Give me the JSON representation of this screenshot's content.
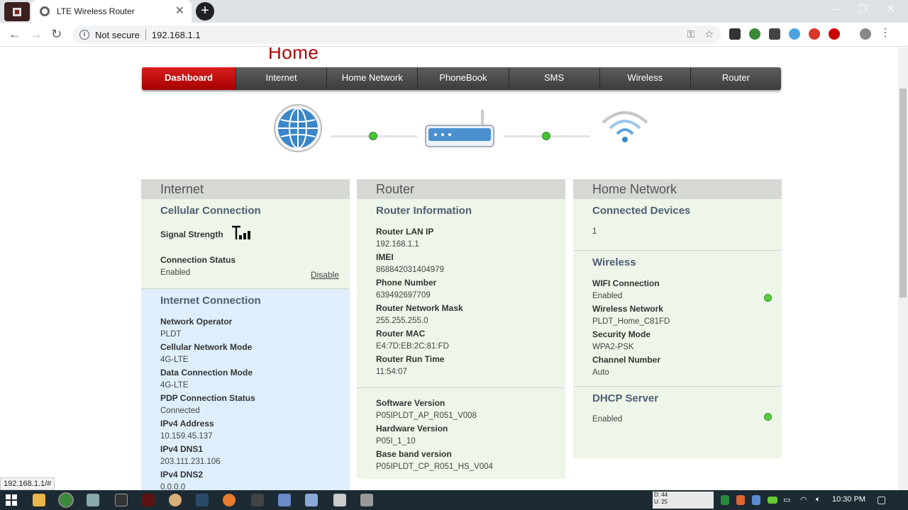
{
  "browser": {
    "tab_title": "LTE Wireless Router",
    "tab_close": "✕",
    "new_tab": "+",
    "not_secure": "Not secure",
    "url": "192.168.1.1",
    "hover_url": "192.168.1.1/#"
  },
  "page": {
    "title": "Home",
    "nav": [
      "Dashboard",
      "Internet",
      "Home Network",
      "PhoneBook",
      "SMS",
      "Wireless",
      "Router"
    ],
    "active_nav": "Dashboard"
  },
  "internet_panel": {
    "heading": "Internet",
    "cellular": {
      "title": "Cellular Connection",
      "signal_label": "Signal Strength",
      "status_label": "Connection Status",
      "status_value": "Enabled",
      "disable_link": "Disable"
    },
    "internet_connection": {
      "title": "Internet Connection",
      "fields": [
        {
          "label": "Network Operator",
          "value": "PLDT"
        },
        {
          "label": "Cellular Network Mode",
          "value": "4G-LTE"
        },
        {
          "label": "Data Connection Mode",
          "value": "4G-LTE"
        },
        {
          "label": "PDP Connection Status",
          "value": "Connected"
        },
        {
          "label": "IPv4 Address",
          "value": "10.159.45.137"
        },
        {
          "label": "IPv4 DNS1",
          "value": "203.111.231.106"
        },
        {
          "label": "IPv4 DNS2",
          "value": "0.0.0.0"
        }
      ]
    }
  },
  "router_panel": {
    "heading": "Router",
    "info": {
      "title": "Router Information",
      "fields": [
        {
          "label": "Router LAN IP",
          "value": "192.168.1.1"
        },
        {
          "label": "IMEI",
          "value": "868842031404979"
        },
        {
          "label": "Phone Number",
          "value": "639492697709"
        },
        {
          "label": "Router Network Mask",
          "value": "255.255.255.0"
        },
        {
          "label": "Router MAC",
          "value": "E4:7D:EB:2C:81:FD"
        },
        {
          "label": "Router Run Time",
          "value": "11:54:07"
        }
      ]
    },
    "versions": {
      "fields": [
        {
          "label": "Software Version",
          "value": "P05IPLDT_AP_R051_V008"
        },
        {
          "label": "Hardware Version",
          "value": "P05I_1_10"
        },
        {
          "label": "Base band version",
          "value": "P05IPLDT_CP_R051_HS_V004"
        }
      ]
    }
  },
  "home_panel": {
    "heading": "Home Network",
    "devices": {
      "title": "Connected Devices",
      "value": "1"
    },
    "wireless": {
      "title": "Wireless",
      "fields": [
        {
          "label": "WIFI Connection",
          "value": "Enabled"
        },
        {
          "label": "Wireless Network",
          "value": "PLDT_Home_C81FD"
        },
        {
          "label": "Security Mode",
          "value": "WPA2-PSK"
        },
        {
          "label": "Channel Number",
          "value": "Auto"
        }
      ]
    },
    "dhcp": {
      "title": "DHCP Server",
      "value": "Enabled"
    }
  },
  "taskbar": {
    "clock": "10:30 PM",
    "net_speed_top": "D: 44",
    "net_speed_bottom": "U: 25"
  },
  "colors": {
    "accent_red": "#b30000",
    "status_green": "#5ac93f"
  }
}
